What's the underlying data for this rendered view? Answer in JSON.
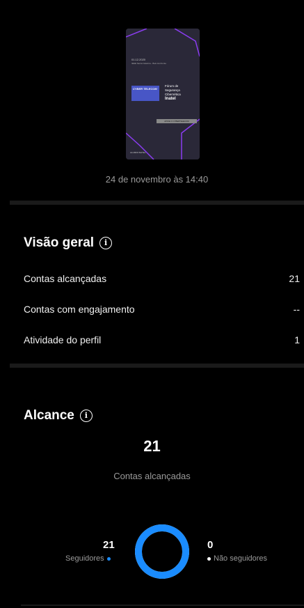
{
  "post": {
    "date_label": "24 de novembro às 14:40",
    "thumb": {
      "date": "01.12.2020",
      "venue": "IEEE Santa Catarina - Belo Horizonte",
      "brand": "CYBER TELECOM",
      "title_line1": "Fórum de",
      "title_line2": "Segurança",
      "title_line3": "Cibernética",
      "org": "Inatel",
      "button": "APOIE O CYBERTELECOM",
      "footer": "ALUMNI INATEL"
    }
  },
  "overview": {
    "title": "Visão geral",
    "rows": [
      {
        "label": "Contas alcançadas",
        "value": "21"
      },
      {
        "label": "Contas com engajamento",
        "value": "--"
      },
      {
        "label": "Atividade do perfil",
        "value": "1"
      }
    ]
  },
  "reach": {
    "title": "Alcance",
    "total": "21",
    "total_label": "Contas alcançadas",
    "followers_value": "21",
    "followers_label": "Seguidores",
    "nonfollowers_value": "0",
    "nonfollowers_label": "Não seguidores",
    "followers_fraction": 1.0
  },
  "colors": {
    "accent": "#1a8cff",
    "ring_track": "#ffffff"
  }
}
